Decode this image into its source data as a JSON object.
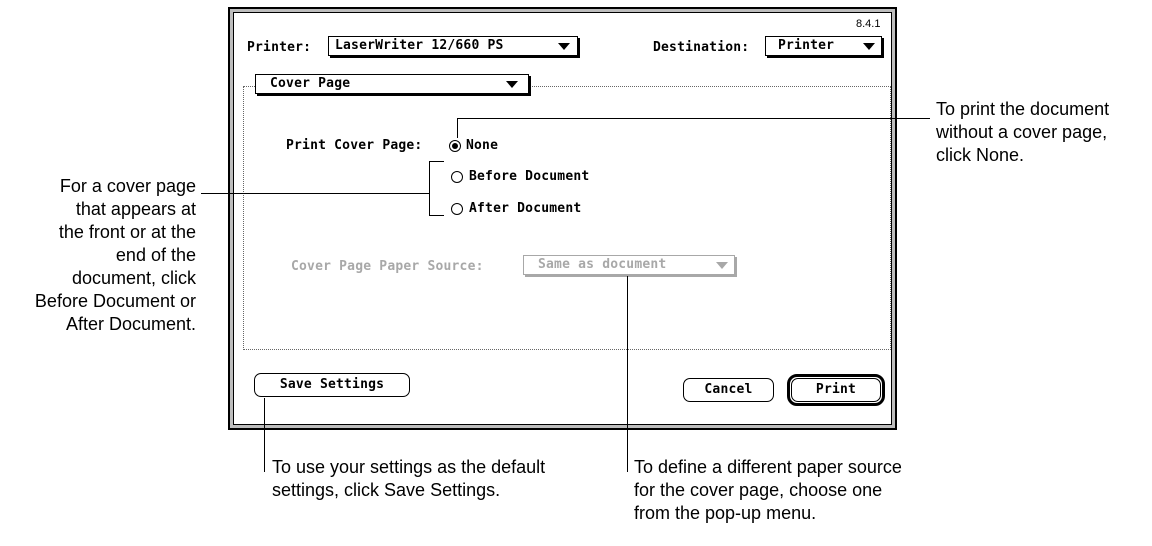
{
  "dialog": {
    "version": "8.4.1",
    "printer_label": "Printer:",
    "printer_value": "LaserWriter 12/660 PS",
    "destination_label": "Destination:",
    "destination_value": "Printer",
    "panel_menu_value": "Cover Page",
    "print_cover_page_label": "Print Cover Page:",
    "options": [
      {
        "label": "None",
        "selected": true
      },
      {
        "label": "Before Document",
        "selected": false
      },
      {
        "label": "After Document",
        "selected": false
      }
    ],
    "paper_source_label": "Cover Page Paper Source:",
    "paper_source_value": "Same as document",
    "save_settings_label": "Save Settings",
    "cancel_label": "Cancel",
    "print_label": "Print"
  },
  "annotations": {
    "none_callout": [
      "To print the document",
      "without a cover page,",
      "click None."
    ],
    "before_after_callout": [
      "For a cover page",
      "that appears at",
      "the front or at the",
      "end of the",
      "document, click",
      "Before Document or",
      "After Document."
    ],
    "save_callout": [
      "To use your settings as the default",
      "settings, click Save Settings."
    ],
    "source_callout": [
      "To define a different paper source",
      "for the cover page, choose one",
      "from the pop-up menu."
    ]
  }
}
